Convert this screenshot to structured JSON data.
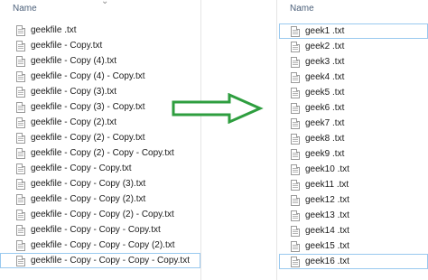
{
  "left_pane": {
    "column_header": "Name",
    "sort_indicator": "⌄",
    "files": [
      "geekfile .txt",
      "geekfile - Copy.txt",
      "geekfile - Copy (4).txt",
      "geekfile - Copy (4) - Copy.txt",
      "geekfile - Copy (3).txt",
      "geekfile - Copy (3) - Copy.txt",
      "geekfile - Copy (2).txt",
      "geekfile - Copy (2) - Copy.txt",
      "geekfile - Copy (2) - Copy - Copy.txt",
      "geekfile - Copy - Copy.txt",
      "geekfile - Copy - Copy (3).txt",
      "geekfile - Copy - Copy (2).txt",
      "geekfile - Copy - Copy (2) - Copy.txt",
      "geekfile - Copy - Copy - Copy.txt",
      "geekfile - Copy - Copy - Copy (2).txt",
      "geekfile - Copy - Copy - Copy - Copy.txt"
    ],
    "selected_file": "geekfile - Copy - Copy - Copy - Copy.txt"
  },
  "right_pane": {
    "column_header": "Name",
    "files": [
      "geek1 .txt",
      "geek2 .txt",
      "geek3 .txt",
      "geek4 .txt",
      "geek5 .txt",
      "geek6 .txt",
      "geek7 .txt",
      "geek8 .txt",
      "geek9 .txt",
      "geek10 .txt",
      "geek11 .txt",
      "geek12 .txt",
      "geek13 .txt",
      "geek14 .txt",
      "geek15 .txt",
      "geek16 .txt"
    ],
    "selected_files": [
      "geek1 .txt",
      "geek16 .txt"
    ]
  },
  "arrow": {
    "icon": "right-arrow-icon",
    "color": "#2e9e3f"
  },
  "colors": {
    "header_text": "#4c607a",
    "selection_border": "#99c9ef",
    "divider": "#e5e5e5"
  }
}
